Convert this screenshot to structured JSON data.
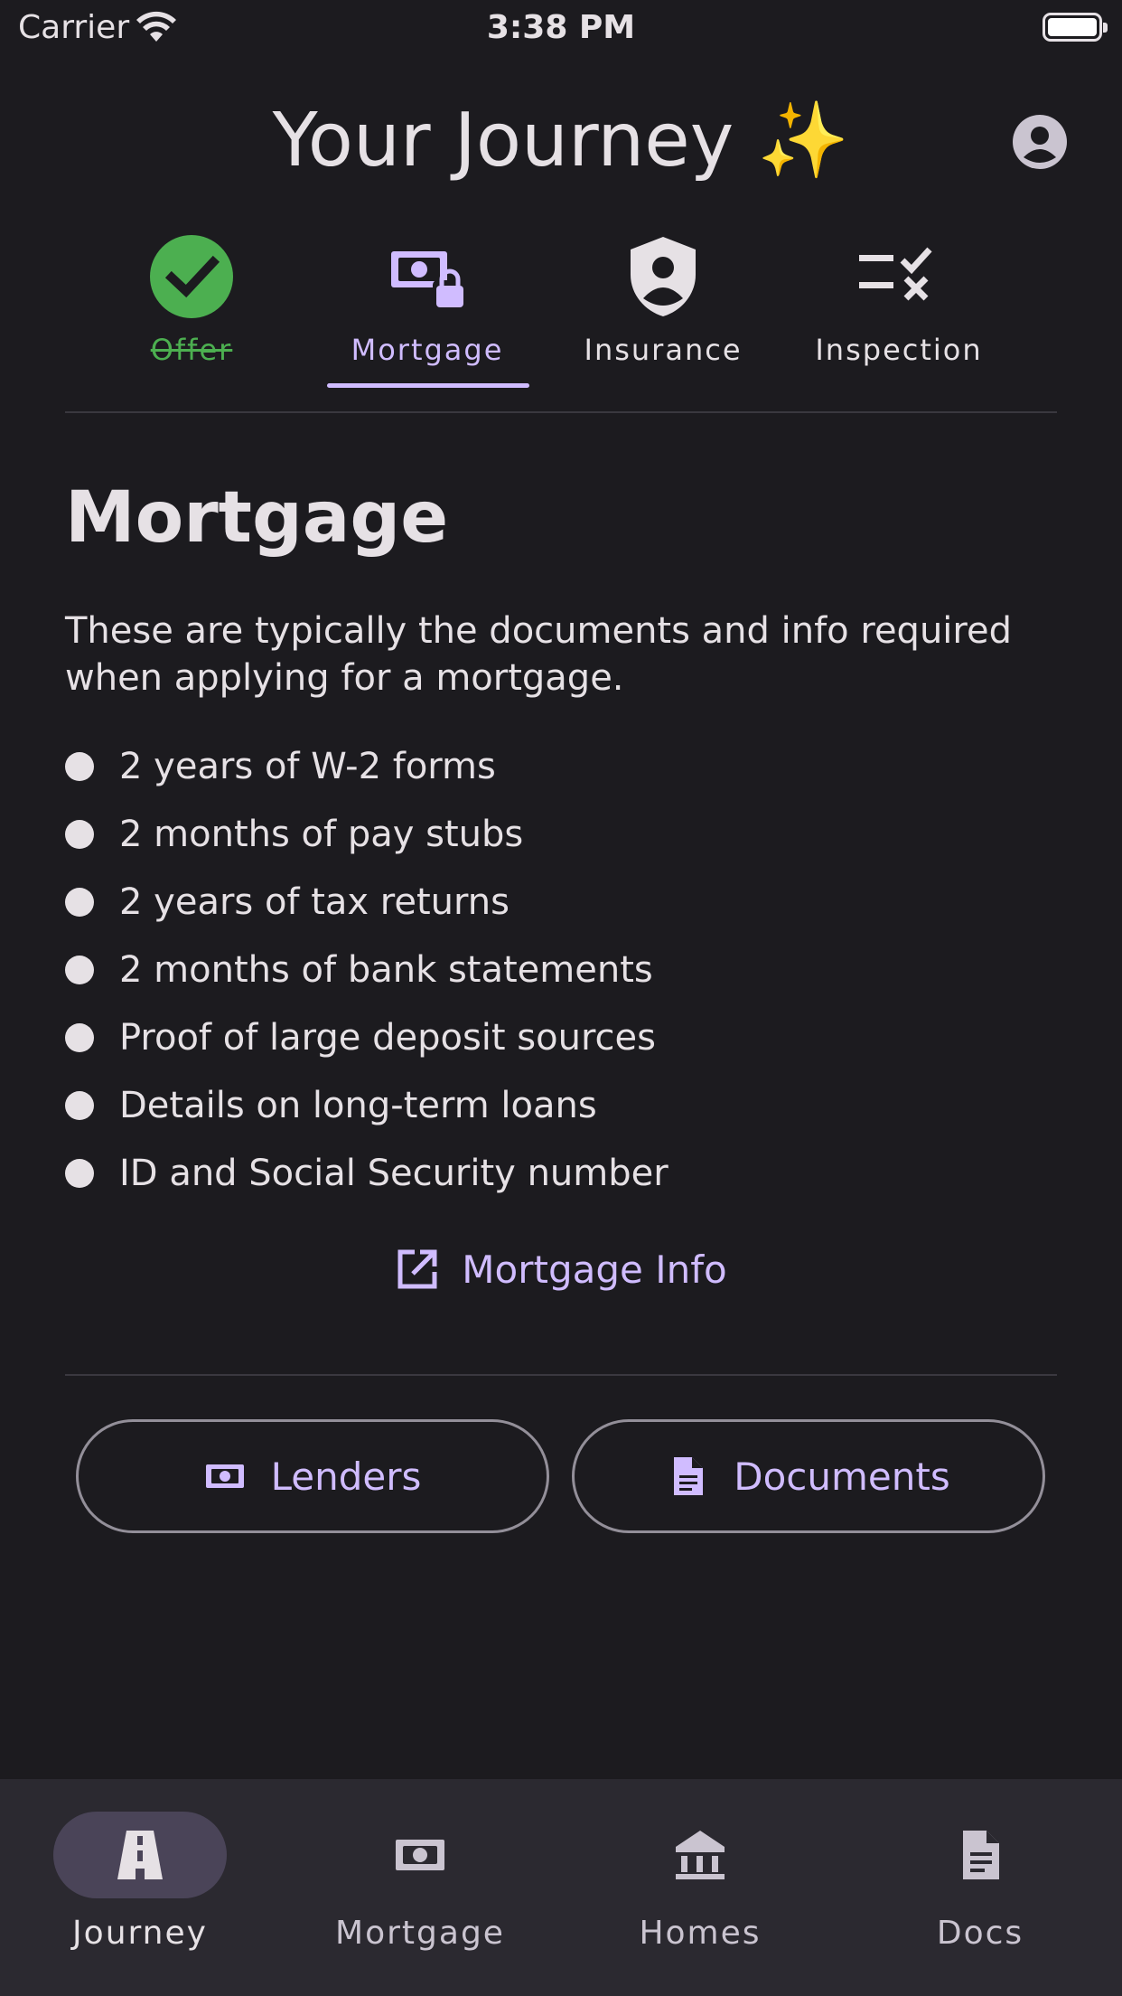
{
  "status_bar": {
    "carrier": "Carrier",
    "time": "3:38 PM"
  },
  "header": {
    "title": "Your Journey ✨",
    "profile_icon": "account-circle-icon"
  },
  "steps": [
    {
      "label": "Offer",
      "icon": "check-circle-icon",
      "state": "completed"
    },
    {
      "label": "Mortgage",
      "icon": "money-lock-icon",
      "state": "active"
    },
    {
      "label": "Insurance",
      "icon": "shield-person-icon",
      "state": "pending"
    },
    {
      "label": "Inspection",
      "icon": "checklist-icon",
      "state": "pending"
    }
  ],
  "content": {
    "title": "Mortgage",
    "intro": "These are typically the documents and info required when applying for a mortgage.",
    "requirements": [
      "2 years of W-2 forms",
      "2 months of pay stubs",
      "2 years of tax returns",
      "2 months of bank statements",
      "Proof of large deposit sources",
      "Details on long-term loans",
      "ID and Social Security number"
    ],
    "info_link": {
      "label": "Mortgage Info",
      "icon": "open-in-new-icon"
    }
  },
  "actions": {
    "lenders": {
      "label": "Lenders",
      "icon": "money-icon"
    },
    "documents": {
      "label": "Documents",
      "icon": "document-icon"
    }
  },
  "bottom_nav": [
    {
      "label": "Journey",
      "icon": "road-icon",
      "selected": true
    },
    {
      "label": "Mortgage",
      "icon": "money-icon",
      "selected": false
    },
    {
      "label": "Homes",
      "icon": "bank-icon",
      "selected": false
    },
    {
      "label": "Docs",
      "icon": "document-icon",
      "selected": false
    }
  ],
  "colors": {
    "background": "#1c1b1f",
    "accent": "#d0bcff",
    "success": "#4caf50",
    "nav_background": "#2b2930",
    "nav_indicator": "#4a4458"
  }
}
